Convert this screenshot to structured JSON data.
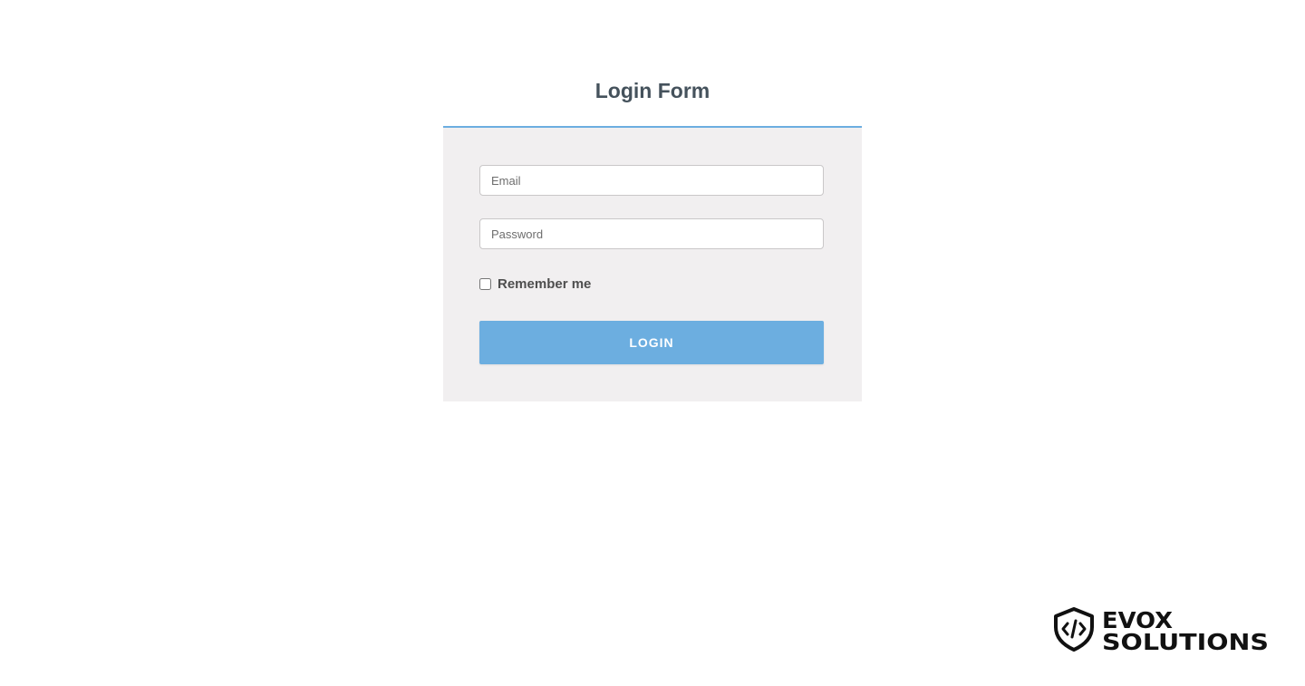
{
  "form": {
    "title": "Login Form",
    "email_placeholder": "Email",
    "password_placeholder": "Password",
    "remember_label": "Remember me",
    "remember_checked": false,
    "login_label": "LOGIN"
  },
  "brand": {
    "line1": "EVOX",
    "line2": "SOLUTIONS",
    "icon": "shield-code-icon"
  },
  "colors": {
    "accent": "#6caee0",
    "panel_background": "#f1eff0",
    "title_text": "#45525c"
  }
}
